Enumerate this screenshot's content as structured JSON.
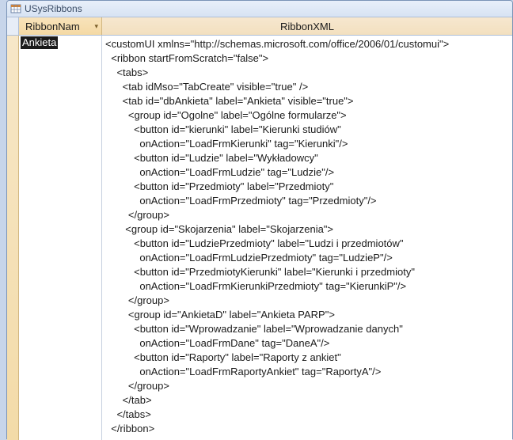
{
  "window": {
    "title": "USysRibbons"
  },
  "columns": {
    "name_header": "RibbonNam",
    "xml_header": "RibbonXML"
  },
  "row": {
    "name_value": "Ankieta"
  },
  "xml_lines": [
    "<customUI xmlns=\"http://schemas.microsoft.com/office/2006/01/customui\">",
    "  <ribbon startFromScratch=\"false\">",
    "    <tabs>",
    "      <tab idMso=\"TabCreate\" visible=\"true\" />",
    "      <tab id=\"dbAnkieta\" label=\"Ankieta\" visible=\"true\">",
    "        <group id=\"Ogolne\" label=\"Ogólne formularze\">",
    "          <button id=\"kierunki\" label=\"Kierunki studiów\"",
    "            onAction=\"LoadFrmKierunki\" tag=\"Kierunki\"/>",
    "          <button id=\"Ludzie\" label=\"Wykładowcy\"",
    "            onAction=\"LoadFrmLudzie\" tag=\"Ludzie\"/>",
    "          <button id=\"Przedmioty\" label=\"Przedmioty\"",
    "            onAction=\"LoadFrmPrzedmioty\" tag=\"Przedmioty\"/>",
    "        </group>",
    "       <group id=\"Skojarzenia\" label=\"Skojarzenia\">",
    "          <button id=\"LudziePrzedmioty\" label=\"Ludzi i przedmiotów\"",
    "            onAction=\"LoadFrmLudziePrzedmioty\" tag=\"LudzieP\"/>",
    "          <button id=\"PrzedmiotyKierunki\" label=\"Kierunki i przedmioty\"",
    "            onAction=\"LoadFrmKierunkiPrzedmioty\" tag=\"KierunkiP\"/>",
    "        </group>",
    "        <group id=\"AnkietaD\" label=\"Ankieta PARP\">",
    "          <button id=\"Wprowadzanie\" label=\"Wprowadzanie danych\"",
    "            onAction=\"LoadFrmDane\" tag=\"DaneA\"/>",
    "          <button id=\"Raporty\" label=\"Raporty z ankiet\"",
    "            onAction=\"LoadFrmRaportyAnkiet\" tag=\"RaportyA\"/>",
    "        </group>",
    "      </tab>",
    "    </tabs>",
    "  </ribbon>"
  ]
}
